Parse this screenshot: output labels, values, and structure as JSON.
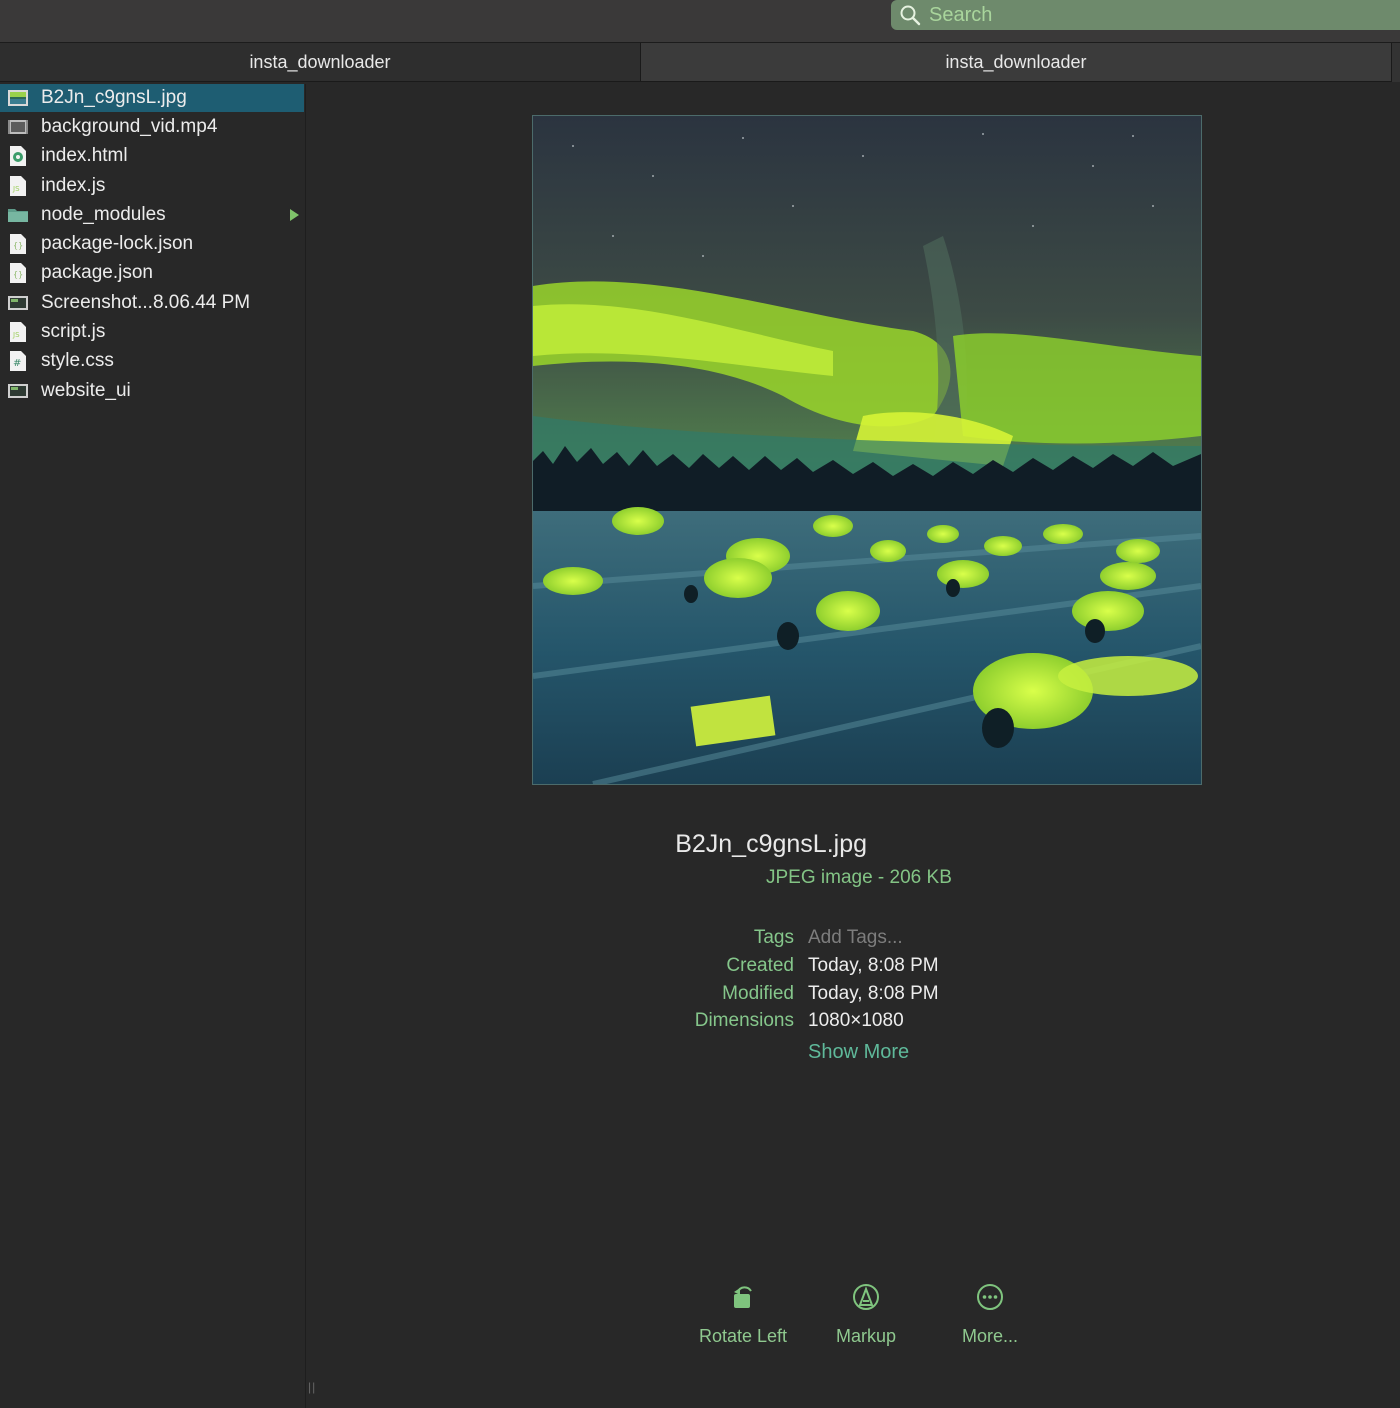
{
  "toolbar": {
    "search_placeholder": "Search",
    "search_color": "#6e8a6c"
  },
  "columns": {
    "left_title": "insta_downloader",
    "right_title": "insta_downloader"
  },
  "files": [
    {
      "name": "B2Jn_c9gnsL.jpg",
      "icon": "image-file-icon",
      "selected": true
    },
    {
      "name": "background_vid.mp4",
      "icon": "video-file-icon",
      "selected": false
    },
    {
      "name": "index.html",
      "icon": "html-file-icon",
      "selected": false
    },
    {
      "name": "index.js",
      "icon": "js-file-icon",
      "selected": false
    },
    {
      "name": "node_modules",
      "icon": "folder-icon",
      "selected": false,
      "is_folder": true
    },
    {
      "name": "package-lock.json",
      "icon": "json-file-icon",
      "selected": false
    },
    {
      "name": "package.json",
      "icon": "json-file-icon",
      "selected": false
    },
    {
      "name": "Screenshot...8.06.44 PM",
      "icon": "image-file-icon",
      "selected": false
    },
    {
      "name": "script.js",
      "icon": "js-file-icon",
      "selected": false
    },
    {
      "name": "style.css",
      "icon": "css-file-icon",
      "selected": false
    },
    {
      "name": "website_ui",
      "icon": "image-file-icon",
      "selected": false
    }
  ],
  "selection_color": "#1e5d72",
  "preview": {
    "image_subject": "aurora borealis over snow igloos",
    "filename": "B2Jn_c9gnsL.jpg",
    "kind_size": "JPEG image - 206 KB",
    "meta": {
      "tags_label": "Tags",
      "tags_placeholder": "Add Tags...",
      "created_label": "Created",
      "created_value": "Today, 8:08 PM",
      "modified_label": "Modified",
      "modified_value": "Today, 8:08 PM",
      "dimensions_label": "Dimensions",
      "dimensions_value": "1080×1080"
    },
    "show_more": "Show More"
  },
  "actions": {
    "rotate_left": "Rotate Left",
    "markup": "Markup",
    "more": "More..."
  },
  "accent_green": "#85c68b"
}
